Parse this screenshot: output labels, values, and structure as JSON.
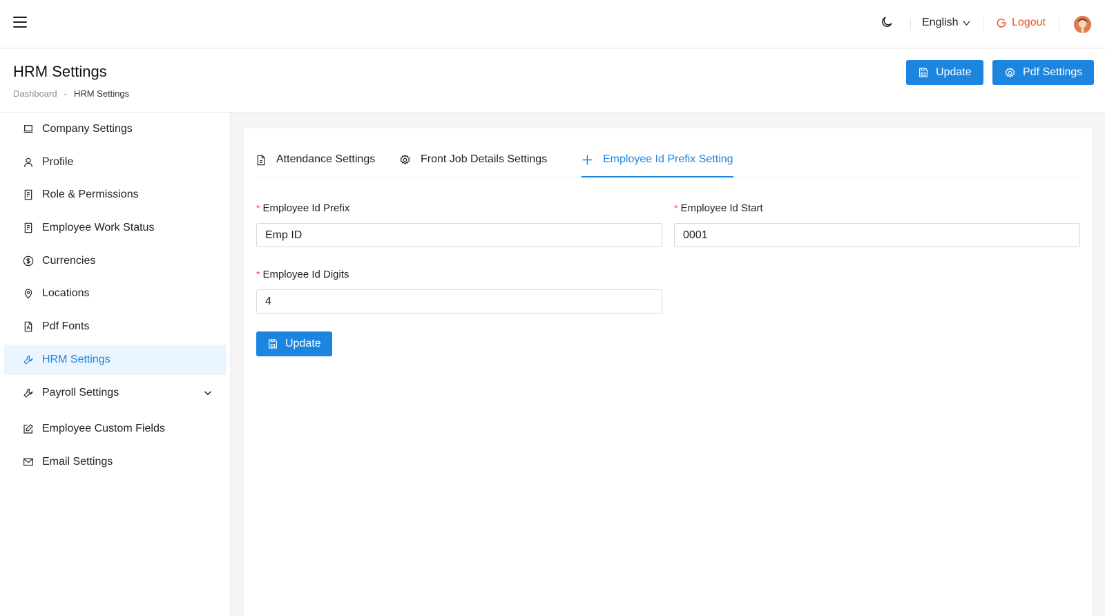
{
  "topbar": {
    "language": "English",
    "logout_label": "Logout"
  },
  "header": {
    "title": "HRM Settings",
    "breadcrumb": [
      "Dashboard",
      "-",
      "HRM Settings"
    ],
    "update_label": "Update",
    "pdf_settings_label": "Pdf Settings"
  },
  "sidebar": {
    "items": [
      {
        "label": "Company Settings",
        "icon": "laptop-icon"
      },
      {
        "label": "Profile",
        "icon": "user-icon"
      },
      {
        "label": "Role & Permissions",
        "icon": "document-list-icon"
      },
      {
        "label": "Employee Work Status",
        "icon": "document-list-icon"
      },
      {
        "label": "Currencies",
        "icon": "dollar-circle-icon"
      },
      {
        "label": "Locations",
        "icon": "location-pin-icon"
      },
      {
        "label": "Pdf Fonts",
        "icon": "pdf-file-icon"
      },
      {
        "label": "HRM Settings",
        "icon": "tool-icon",
        "active": true
      },
      {
        "label": "Payroll Settings",
        "icon": "tool-icon",
        "has_submenu": true
      },
      {
        "label": "Employee Custom Fields",
        "icon": "edit-icon"
      },
      {
        "label": "Email Settings",
        "icon": "mail-icon"
      }
    ]
  },
  "tabs": [
    {
      "label": "Attendance Settings",
      "icon": "file-icon"
    },
    {
      "label": "Front Job Details Settings",
      "icon": "gear-icon"
    },
    {
      "label": "Employee Id Prefix Setting",
      "icon": "plus-icon",
      "active": true
    }
  ],
  "form": {
    "prefix_label": "Employee Id Prefix",
    "prefix_value": "Emp ID",
    "start_label": "Employee Id Start",
    "start_value": "0001",
    "digits_label": "Employee Id Digits",
    "digits_value": "4",
    "required_mark": "*",
    "submit_label": "Update"
  },
  "colors": {
    "primary": "#1b85e0",
    "logout": "#e8502a",
    "required": "#ff4d4f",
    "active_bg": "#eaf5ff"
  }
}
